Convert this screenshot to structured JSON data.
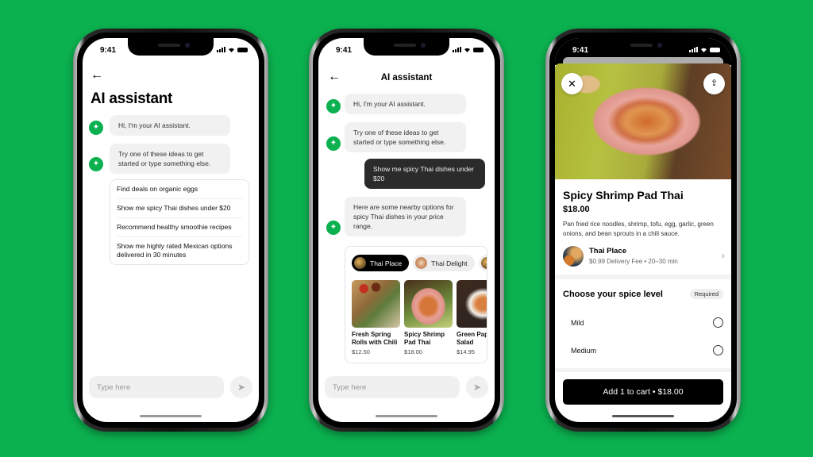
{
  "colors": {
    "background": "#0bb14f",
    "accent": "#0bb14f",
    "user_bubble": "#2b2b2b"
  },
  "status_bar": {
    "time": "9:41",
    "icons": [
      "signal-icon",
      "wifi-icon",
      "battery-icon"
    ]
  },
  "phone1": {
    "back_icon": "←",
    "title": "AI assistant",
    "ai_icon": "sparkle-icon",
    "messages": [
      {
        "from": "ai",
        "text": "Hi, I'm your AI assistant."
      },
      {
        "from": "ai",
        "text": "Try one of these ideas to get started or type something else."
      }
    ],
    "suggestions": [
      "Find deals on organic eggs",
      "Show me spicy Thai dishes under $20",
      "Recommend healthy smoothie recipes",
      "Show me highly rated Mexican options delivered in 30 minutes"
    ],
    "composer": {
      "placeholder": "Type here",
      "send_icon": "➤"
    }
  },
  "phone2": {
    "back_icon": "←",
    "title": "AI assistant",
    "messages": [
      {
        "from": "ai",
        "text": "Hi, I'm your AI assistant."
      },
      {
        "from": "ai",
        "text": "Try one of these ideas to get started or type something else."
      },
      {
        "from": "user",
        "text": "Show me spicy Thai dishes under $20"
      },
      {
        "from": "ai",
        "text": "Here are some nearby options for spicy Thai dishes in your price range."
      }
    ],
    "store_chips": [
      {
        "label": "Thai Place",
        "active": true
      },
      {
        "label": "Thai Delight",
        "active": false
      }
    ],
    "dishes": [
      {
        "name": "Fresh Spring Rolls with Chili",
        "price": "$12.50"
      },
      {
        "name": "Spicy Shrimp Pad Thai",
        "price": "$18.00"
      },
      {
        "name": "Green Papaya Salad",
        "price": "$14.95"
      }
    ],
    "composer": {
      "placeholder": "Type here",
      "send_icon": "➤"
    }
  },
  "phone3": {
    "close_icon": "✕",
    "share_icon": "⇪",
    "dish": {
      "title": "Spicy Shrimp Pad Thai",
      "price": "$18.00",
      "description": "Pan fried rice noodles, shrimp, tofu, egg, garlic, green onions, and bean sprouts in a chili sauce."
    },
    "store": {
      "name": "Thai Place",
      "meta": "$0.99 Delivery Fee • 20–30 min",
      "chevron": "›"
    },
    "spice": {
      "title": "Choose your spice level",
      "badge": "Required",
      "options": [
        "Mild",
        "Medium"
      ]
    },
    "cart_button": "Add 1 to cart • $18.00"
  }
}
